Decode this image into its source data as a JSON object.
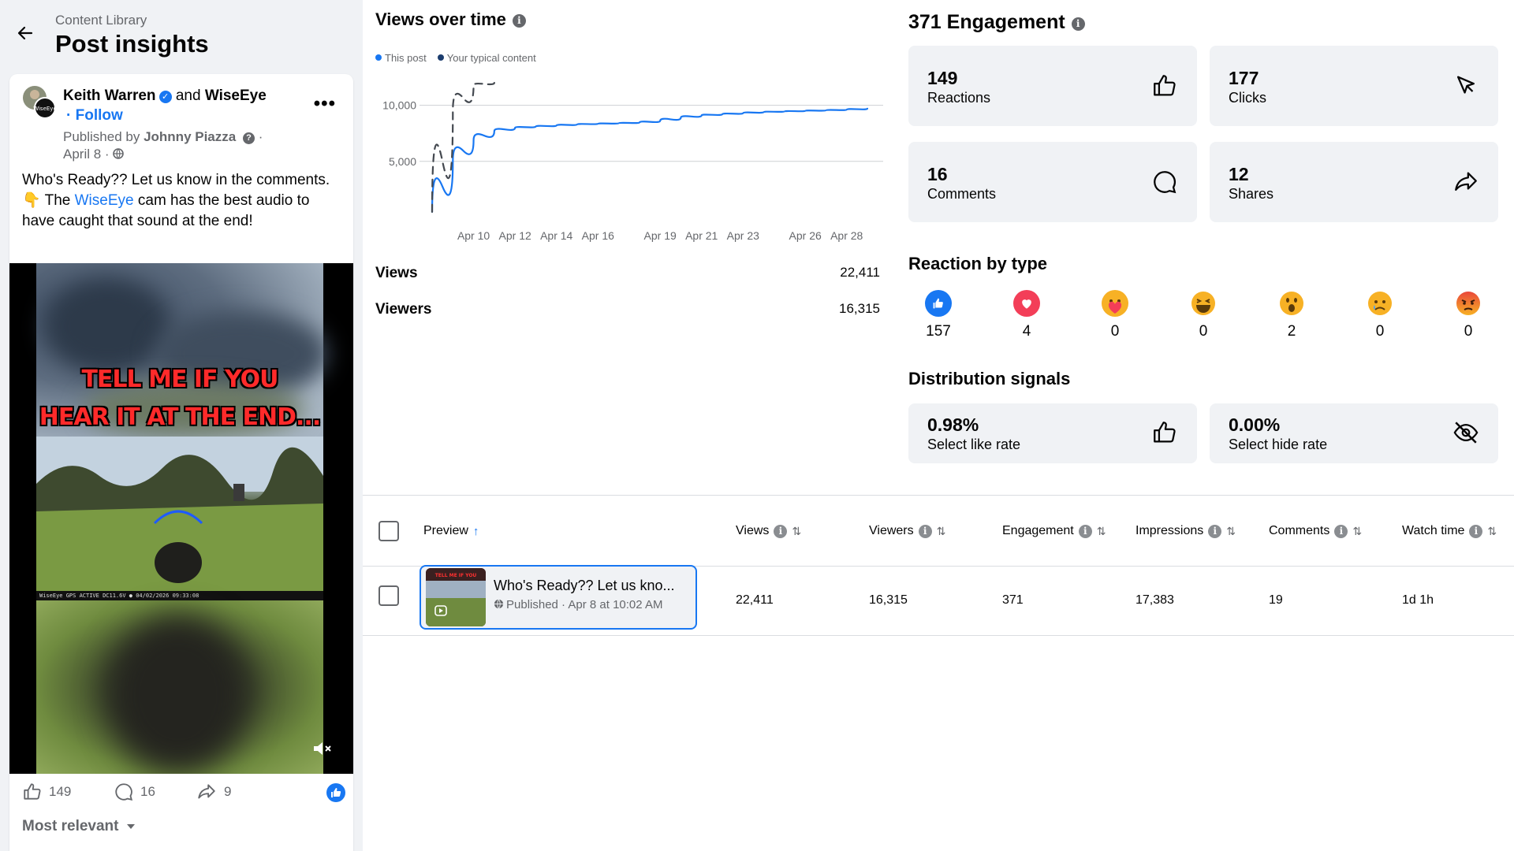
{
  "header": {
    "breadcrumb": "Content Library",
    "title": "Post insights"
  },
  "post": {
    "author": "Keith Warren",
    "and_text": "and",
    "coauthor": "WiseEye",
    "follow_label": "· Follow",
    "published_prefix": "Published by",
    "publisher": "Johnny Piazza",
    "date": "April 8 ·",
    "text_part1": "Who's Ready?? Let us know in the comments. 👇 The ",
    "text_link": "WiseEye",
    "text_part2": " cam has the best audio to have caught that sound at the end!",
    "overlay_line1": "TELL ME IF YOU",
    "overlay_line2": "HEAR IT AT THE END...",
    "video_strip": "WiseEye GPS ACTIVE          DC11.6V  ●  04/02/2026 09:33:08",
    "likes": "149",
    "comments": "16",
    "shares": "9",
    "most_relevant": "Most relevant"
  },
  "views_over_time": {
    "title": "Views over time",
    "legend_this": "This post",
    "legend_typical": "Your typical content",
    "views_label": "Views",
    "views_value": "22,411",
    "viewers_label": "Viewers",
    "viewers_value": "16,315"
  },
  "chart_data": {
    "type": "line",
    "x": [
      "Apr 8",
      "Apr 9",
      "Apr 10",
      "Apr 11",
      "Apr 12",
      "Apr 13",
      "Apr 14",
      "Apr 15",
      "Apr 16",
      "Apr 17",
      "Apr 18",
      "Apr 19",
      "Apr 20",
      "Apr 21",
      "Apr 22",
      "Apr 23",
      "Apr 24",
      "Apr 25",
      "Apr 26",
      "Apr 27",
      "Apr 28",
      "Apr 29"
    ],
    "x_ticks": [
      "Apr 10",
      "Apr 12",
      "Apr 14",
      "Apr 16",
      "Apr 19",
      "Apr 21",
      "Apr 23",
      "Apr 26",
      "Apr 28"
    ],
    "y_ticks": [
      "5,000",
      "10,000"
    ],
    "ylim": [
      0,
      12500
    ],
    "series": [
      {
        "name": "This post",
        "color": "#1877f2",
        "values": [
          500,
          5000,
          6900,
          7700,
          8000,
          8100,
          8200,
          8300,
          8350,
          8400,
          8450,
          8600,
          8900,
          9100,
          9200,
          9300,
          9400,
          9450,
          9500,
          9550,
          9600,
          9700
        ]
      },
      {
        "name": "Your typical content",
        "color": "#444950",
        "values": [
          500,
          9500,
          11800,
          12000
        ]
      }
    ],
    "legend": "top-left",
    "grid": true
  },
  "engagement": {
    "title": "371 Engagement",
    "cards": [
      {
        "value": "149",
        "label": "Reactions"
      },
      {
        "value": "177",
        "label": "Clicks"
      },
      {
        "value": "16",
        "label": "Comments"
      },
      {
        "value": "12",
        "label": "Shares"
      }
    ],
    "reaction_title": "Reaction by type",
    "reactions": [
      {
        "name": "like",
        "count": "157"
      },
      {
        "name": "love",
        "count": "4"
      },
      {
        "name": "care",
        "count": "0"
      },
      {
        "name": "haha",
        "count": "0"
      },
      {
        "name": "wow",
        "count": "2"
      },
      {
        "name": "sad",
        "count": "0"
      },
      {
        "name": "angry",
        "count": "0"
      }
    ],
    "distribution_title": "Distribution signals",
    "distribution": [
      {
        "value": "0.98%",
        "label": "Select like rate"
      },
      {
        "value": "0.00%",
        "label": "Select hide rate"
      }
    ]
  },
  "table": {
    "headers": {
      "preview": "Preview",
      "views": "Views",
      "viewers": "Viewers",
      "engagement": "Engagement",
      "impressions": "Impressions",
      "comments": "Comments",
      "watch_time": "Watch time"
    },
    "row": {
      "title": "Who's Ready?? Let us kno...",
      "meta": "Published · Apr 8 at 10:02 AM",
      "views": "22,411",
      "viewers": "16,315",
      "engagement": "371",
      "impressions": "17,383",
      "comments": "19",
      "watch_time": "1d 1h"
    }
  },
  "colors": {
    "accent": "#1877f2",
    "card_bg": "#f0f2f5",
    "text": "#050505",
    "muted": "#65676b"
  }
}
